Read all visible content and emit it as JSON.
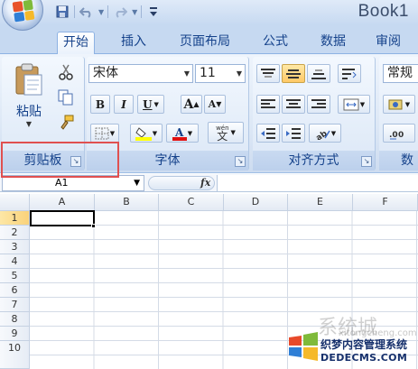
{
  "window": {
    "title": "Book1"
  },
  "tabs": [
    "开始",
    "插入",
    "页面布局",
    "公式",
    "数据",
    "审阅"
  ],
  "ribbon": {
    "clipboard": {
      "label": "剪贴板",
      "paste_label": "粘贴"
    },
    "font": {
      "label": "字体",
      "font_name": "宋体",
      "font_size": "11",
      "grow": "A",
      "shrink": "A",
      "phonetic": "wén",
      "phonetic_char": "文"
    },
    "alignment": {
      "label": "对齐方式"
    },
    "number": {
      "format": "常规",
      "label": "数"
    }
  },
  "formula_bar": {
    "name_box": "A1",
    "fx": "fx"
  },
  "grid": {
    "columns": [
      "A",
      "B",
      "C",
      "D",
      "E",
      "F"
    ],
    "rows": [
      "1",
      "2",
      "3",
      "4",
      "5",
      "6",
      "7",
      "8",
      "9",
      "10"
    ]
  },
  "watermark": {
    "brand": "系统城",
    "line1": "织梦内容管理系统",
    "line2": "DEDECMS.COM",
    "faint": "xitongcheng.com"
  },
  "colors": {
    "accent": "#15428b",
    "selection_box": "#e05050"
  }
}
